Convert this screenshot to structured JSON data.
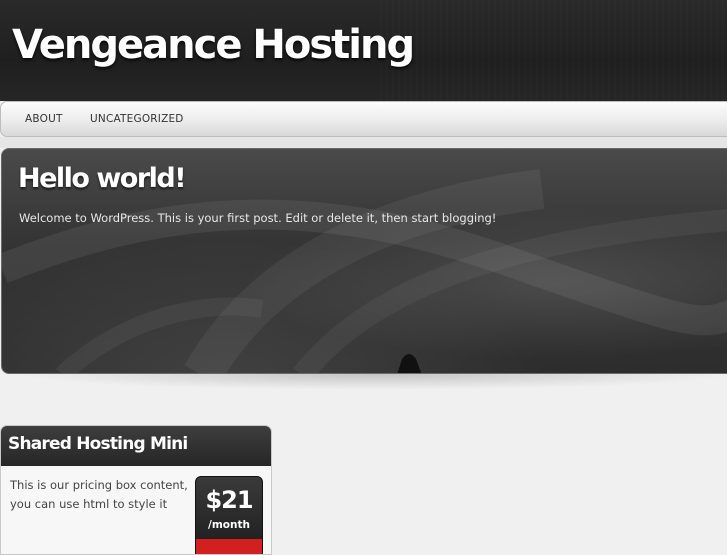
{
  "site": {
    "title": "Vengeance Hosting"
  },
  "nav": {
    "items": [
      {
        "label": "ABOUT"
      },
      {
        "label": "UNCATEGORIZED"
      }
    ]
  },
  "featured_post": {
    "title": "Hello world!",
    "excerpt": "Welcome to WordPress. This is your first post. Edit or delete it, then start blogging!"
  },
  "pricing_box": {
    "title": "Shared Hosting Mini",
    "content": "This is our pricing box content, you can use html to style it",
    "price": "$21",
    "period": "/month"
  },
  "colors": {
    "header_bg": "#222222",
    "nav_bg": "#ececec",
    "featured_bg": "#353535",
    "accent_red": "#d21f1f"
  }
}
